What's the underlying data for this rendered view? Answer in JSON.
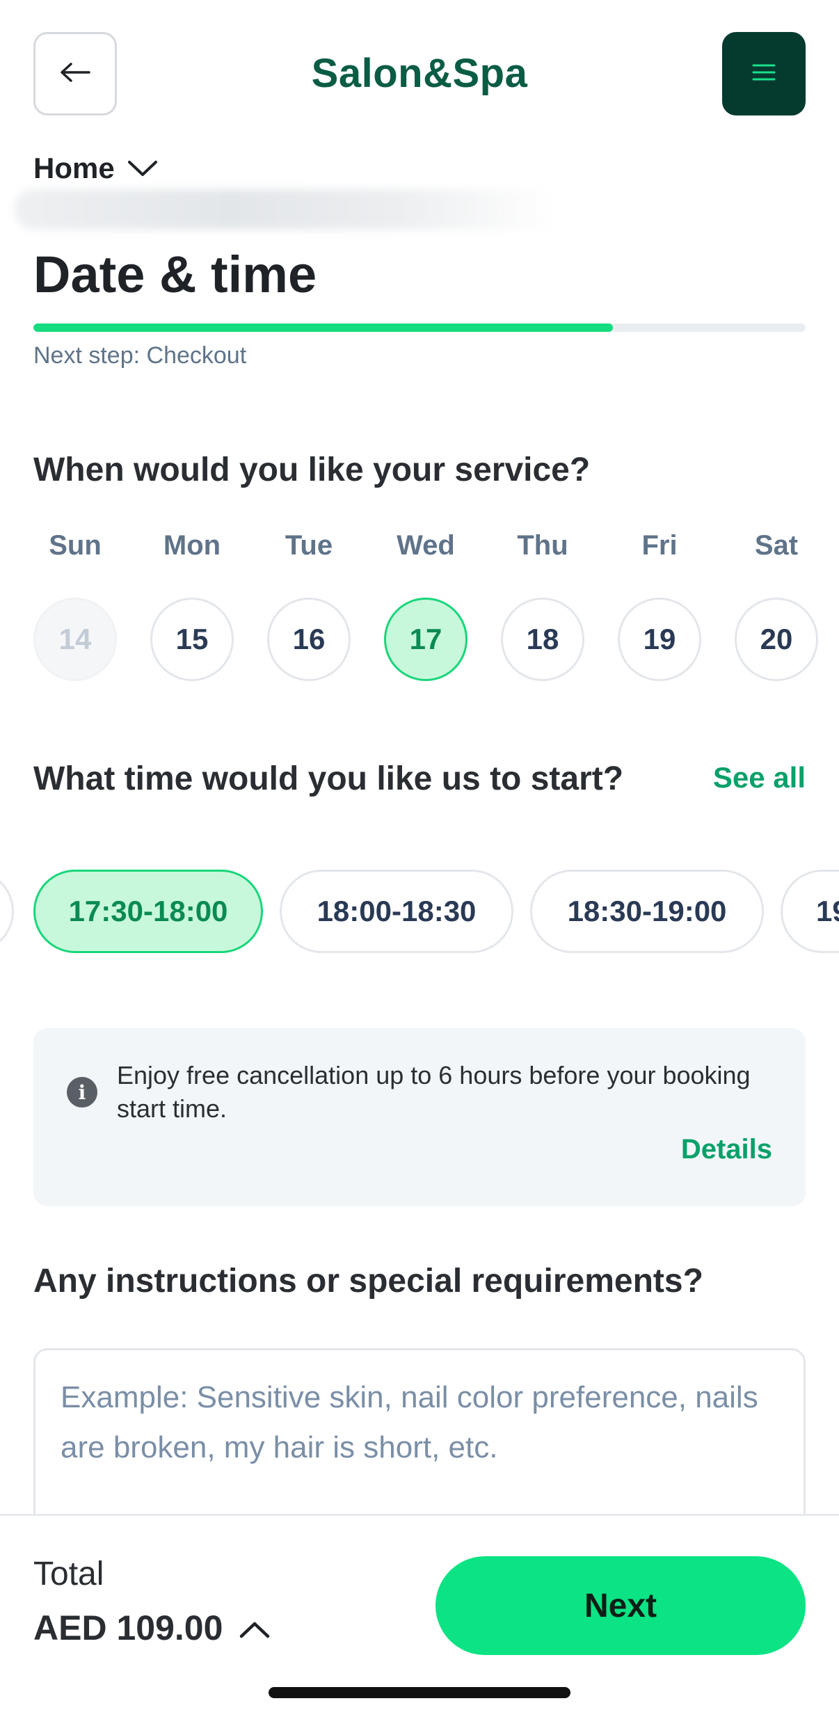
{
  "header": {
    "back_icon": "arrow-left-icon",
    "brand": "Salon&Spa",
    "menu_icon": "hamburger-menu-icon",
    "accent_color": "#053a2f"
  },
  "breadcrumb": {
    "label": "Home",
    "icon": "chevron-down-icon"
  },
  "page": {
    "title": "Date & time",
    "progress_fraction": 0.75,
    "next_step": "Next step: Checkout"
  },
  "date_section": {
    "question": "When would you like your service?",
    "days": [
      {
        "name": "Sun",
        "date": "14",
        "state": "disabled"
      },
      {
        "name": "Mon",
        "date": "15",
        "state": "default"
      },
      {
        "name": "Tue",
        "date": "16",
        "state": "default"
      },
      {
        "name": "Wed",
        "date": "17",
        "state": "selected"
      },
      {
        "name": "Thu",
        "date": "18",
        "state": "default"
      },
      {
        "name": "Fri",
        "date": "19",
        "state": "default"
      },
      {
        "name": "Sat",
        "date": "20",
        "state": "default"
      }
    ]
  },
  "time_section": {
    "question": "What time would you like us to start?",
    "see_all": "See all",
    "slots": [
      {
        "label": "",
        "state": "default"
      },
      {
        "label": "17:30-18:00",
        "state": "selected"
      },
      {
        "label": "18:00-18:30",
        "state": "default"
      },
      {
        "label": "18:30-19:00",
        "state": "default"
      },
      {
        "label": "19",
        "state": "default"
      }
    ]
  },
  "info": {
    "icon": "info-icon",
    "text": "Enjoy free cancellation up to 6 hours before your booking start time.",
    "link": "Details"
  },
  "instructions": {
    "question": "Any instructions or special requirements?",
    "placeholder": "Example: Sensitive skin, nail color preference, nails are broken, my hair is short, etc.",
    "value": ""
  },
  "footer": {
    "total_label": "Total",
    "total_value": "AED 109.00",
    "expand_icon": "chevron-up-icon",
    "next_label": "Next",
    "next_color": "#0ce384"
  }
}
